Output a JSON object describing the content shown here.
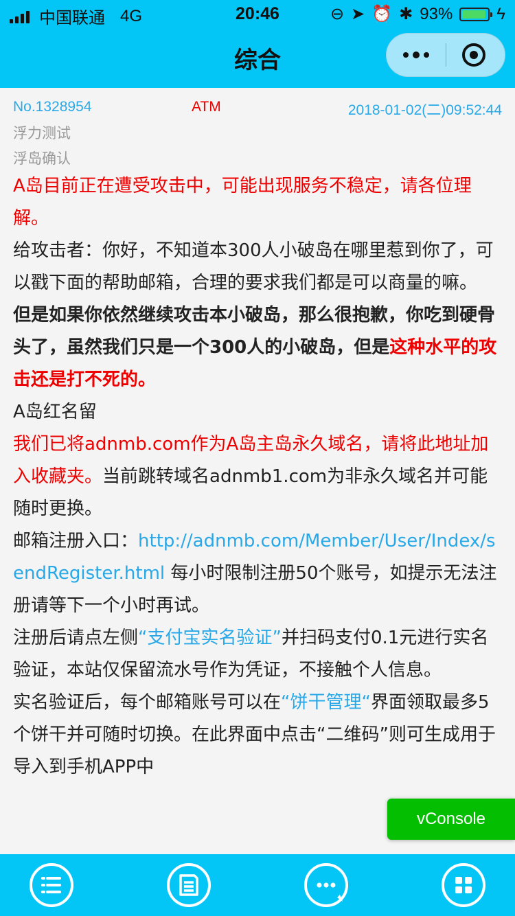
{
  "status_bar": {
    "carrier": "中国联通",
    "network": "4G",
    "time": "20:46",
    "battery_percent": "93%",
    "battery_level": 0.93
  },
  "nav": {
    "title": "综合"
  },
  "post": {
    "number": "No.1328954",
    "uid": "ATM",
    "datetime": "2018-01-02(二)09:52:44",
    "subtitle1": "浮力测试",
    "subtitle2": "浮岛确认",
    "p1": "A岛目前正在遭受攻击中，可能出现服务不稳定，请各位理解。",
    "p2": "给攻击者：你好，不知道本300人小破岛在哪里惹到你了，可以戳下面的帮助邮箱，合理的要求我们都是可以商量的嘛。",
    "p3_bold": "但是如果你依然继续攻击本小破岛，那么很抱歉，你吃到硬骨头了，虽然我们只是一个300人的小破岛，但是",
    "p3_red": "这种水平的攻击还是打不死的。",
    "p4": "A岛红名留",
    "p5_red": "我们已将adnmb.com作为A岛主岛永久域名，请将此地址加入收藏夹。",
    "p5_rest": "当前跳转域名adnmb1.com为非永久域名并可能随时更换。",
    "p6_prefix": "邮箱注册入口：",
    "p6_link": "http://adnmb.com/Member/User/Index/sendRegister.html",
    "p6_suffix": " 每小时限制注册50个账号，如提示无法注册请等下一个小时再试。",
    "p7_prefix": "注册后请点左侧",
    "p7_link": "“支付宝实名验证”",
    "p7_suffix": "并扫码支付0.1元进行实名验证，本站仅保留流水号作为凭证，不接触个人信息。",
    "p8_prefix": "实名验证后，每个邮箱账号可以在",
    "p8_link": "“饼干管理“",
    "p8_suffix": "界面领取最多5个饼干并可随时切换。在此界面中点击“二维码”则可生成用于导入到手机APP中"
  },
  "vconsole": {
    "label": "vConsole"
  },
  "tabbar": {
    "icons": [
      "list-icon",
      "document-icon",
      "chat-icon",
      "grid-icon"
    ]
  }
}
